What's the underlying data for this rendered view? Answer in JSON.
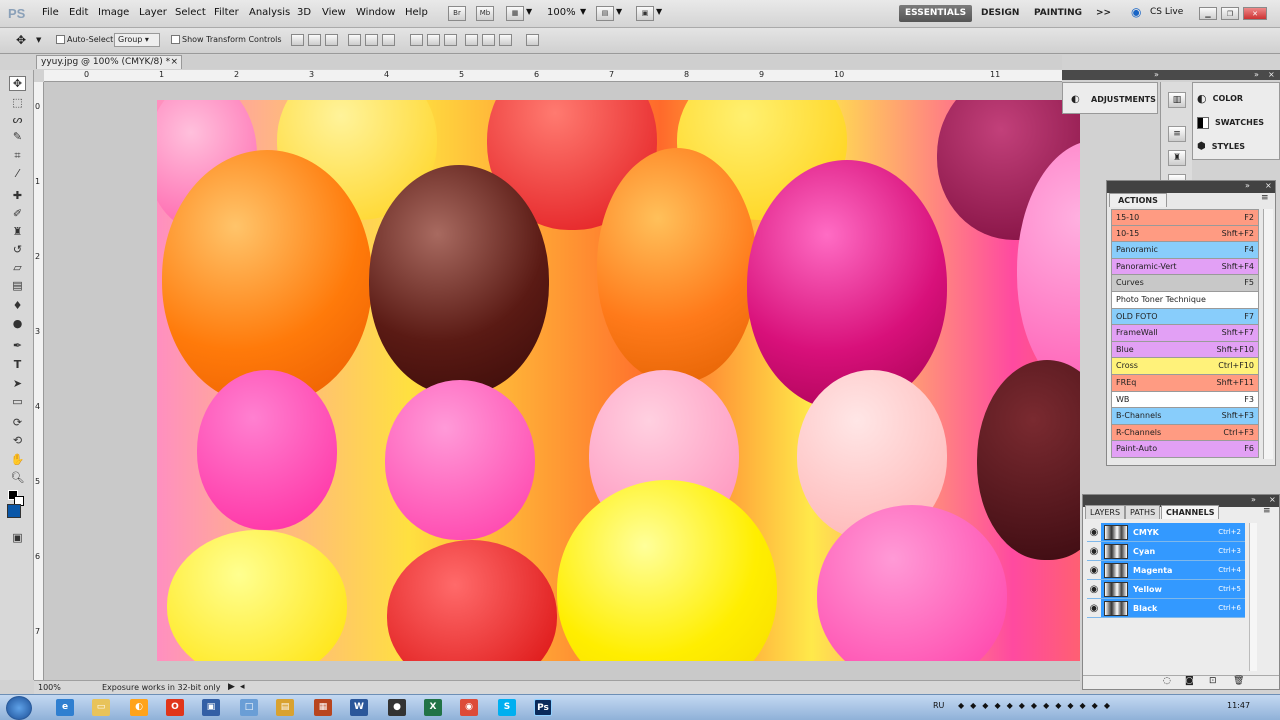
{
  "app": {
    "logo": "PS"
  },
  "menu": [
    "File",
    "Edit",
    "Image",
    "Layer",
    "Select",
    "Filter",
    "Analysis",
    "3D",
    "View",
    "Window",
    "Help"
  ],
  "menubar_buttons": [
    "Br",
    "Mb"
  ],
  "zoom": "100%",
  "workspaces": {
    "essentials": "ESSENTIALS",
    "design": "DESIGN",
    "painting": "PAINTING",
    "more": ">>"
  },
  "cs_live": "CS Live",
  "options": {
    "auto_select": "Auto-Select:",
    "auto_select_value": "Group",
    "show_transform": "Show Transform Controls"
  },
  "document": {
    "tab_title": "yyuy.jpg @ 100% (CMYK/8) *",
    "close": "×"
  },
  "rulers": {
    "h": [
      "0",
      "1",
      "2",
      "3",
      "4",
      "5",
      "6",
      "7",
      "8",
      "9",
      "10",
      "11"
    ],
    "v": [
      "0",
      "1",
      "2",
      "3",
      "4",
      "5",
      "6",
      "7"
    ]
  },
  "status": {
    "zoom": "100%",
    "message": "Exposure works in 32-bit only"
  },
  "adjustments": {
    "label": "ADJUSTMENTS"
  },
  "color_group": [
    {
      "label": "COLOR"
    },
    {
      "label": "SWATCHES"
    },
    {
      "label": "STYLES"
    }
  ],
  "actions": {
    "tab": "ACTIONS",
    "items": [
      {
        "name": "15-10",
        "key": "F2",
        "color": "#ff9b82"
      },
      {
        "name": "10-15",
        "key": "Shft+F2",
        "color": "#ff9b82"
      },
      {
        "name": "Panoramic",
        "key": "F4",
        "color": "#88cdfb"
      },
      {
        "name": "Panoramic-Vert",
        "key": "Shft+F4",
        "color": "#e2a0f5"
      },
      {
        "name": "Curves",
        "key": "F5",
        "color": "#c8c8c8"
      },
      {
        "name": "Photo Toner Technique",
        "key": "",
        "color": "#ffffff"
      },
      {
        "name": "OLD FOTO",
        "key": "F7",
        "color": "#88cdfb"
      },
      {
        "name": "FrameWall",
        "key": "Shft+F7",
        "color": "#e2a0f5"
      },
      {
        "name": "Blue",
        "key": "Shft+F10",
        "color": "#e2a0f5"
      },
      {
        "name": "Cross",
        "key": "Ctrl+F10",
        "color": "#fff27a"
      },
      {
        "name": "FREq",
        "key": "Shft+F11",
        "color": "#ff9b82"
      },
      {
        "name": "WB",
        "key": "F3",
        "color": "#ffffff"
      },
      {
        "name": "B-Channels",
        "key": "Shft+F3",
        "color": "#88cdfb"
      },
      {
        "name": "R-Channels",
        "key": "Ctrl+F3",
        "color": "#ff9b82"
      },
      {
        "name": "Paint-Auto",
        "key": "F6",
        "color": "#e2a0f5"
      }
    ]
  },
  "layers_panel": {
    "tabs": [
      "LAYERS",
      "PATHS",
      "CHANNELS"
    ],
    "channels": [
      {
        "name": "CMYK",
        "key": "Ctrl+2"
      },
      {
        "name": "Cyan",
        "key": "Ctrl+3"
      },
      {
        "name": "Magenta",
        "key": "Ctrl+4"
      },
      {
        "name": "Yellow",
        "key": "Ctrl+5"
      },
      {
        "name": "Black",
        "key": "Ctrl+6"
      }
    ]
  },
  "taskbar": {
    "lang": "RU",
    "time": "11:47"
  }
}
